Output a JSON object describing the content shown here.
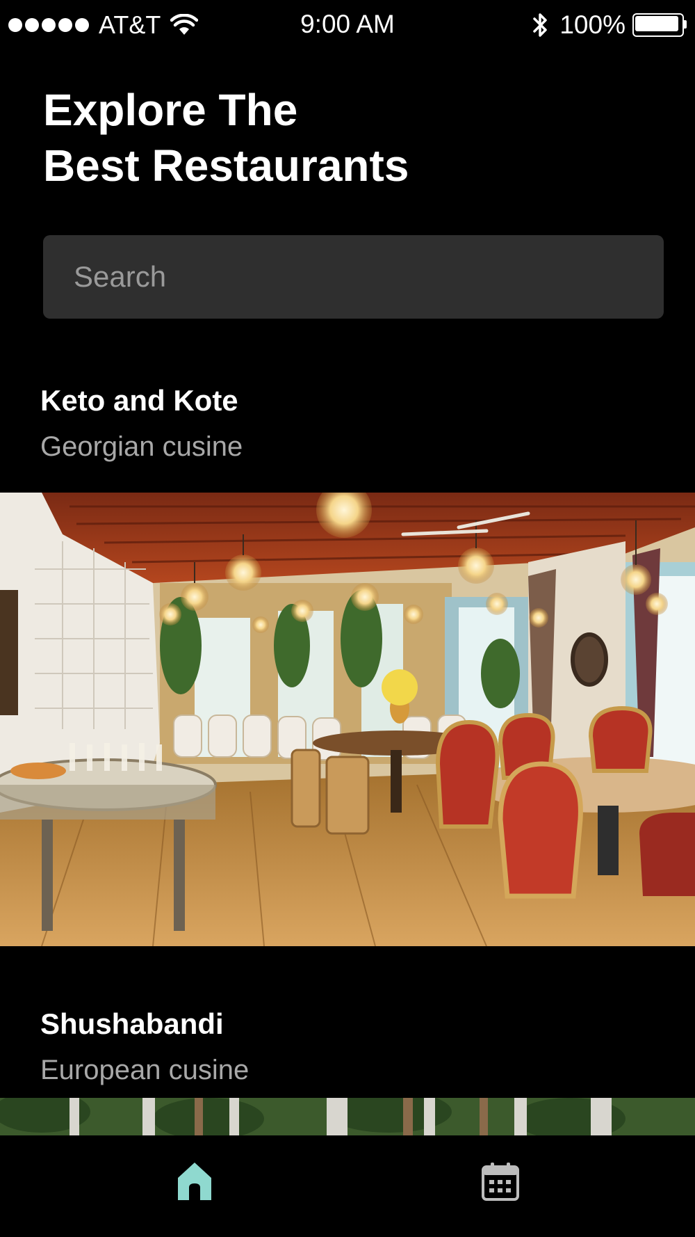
{
  "status_bar": {
    "carrier": "AT&T",
    "time": "9:00 AM",
    "battery": "100%"
  },
  "header": {
    "title_line1": "Explore The",
    "title_line2": "Best Restaurants"
  },
  "search": {
    "placeholder": "Search",
    "value": ""
  },
  "restaurants": [
    {
      "name": "Keto and Kote",
      "cuisine": "Georgian cusine"
    },
    {
      "name": "Shushabandi",
      "cuisine": "European cusine"
    }
  ],
  "tab_bar": {
    "items": [
      {
        "icon": "home-icon",
        "active": true
      },
      {
        "icon": "calendar-icon",
        "active": false
      }
    ],
    "active_color": "#8fd9cf",
    "inactive_color": "#bdbdbd"
  }
}
